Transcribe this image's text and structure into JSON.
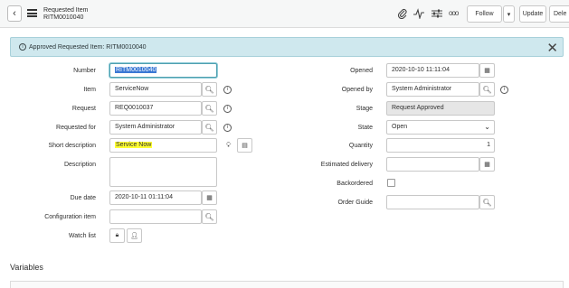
{
  "header": {
    "record_type": "Requested Item",
    "record_number": "RITM0010040",
    "follow_label": "Follow",
    "update_label": "Update",
    "delete_label": "Dele",
    "more_label": "ooo"
  },
  "banner": {
    "message": "Approved Requested Item: RITM0010040"
  },
  "form": {
    "left": {
      "number": {
        "label": "Number",
        "value": "RITM0010040"
      },
      "item": {
        "label": "Item",
        "value": "ServiceNow"
      },
      "request": {
        "label": "Request",
        "value": "REQ0010037"
      },
      "requested_for": {
        "label": "Requested for",
        "value": "System Administrator"
      },
      "short_description": {
        "label": "Short description",
        "value": "Service Now"
      },
      "description": {
        "label": "Description",
        "value": ""
      },
      "due_date": {
        "label": "Due date",
        "value": "2020-10-11 01:11:04"
      },
      "configuration_item": {
        "label": "Configuration item",
        "value": ""
      },
      "watch_list": {
        "label": "Watch list"
      }
    },
    "right": {
      "opened": {
        "label": "Opened",
        "value": "2020-10-10 11:11:04"
      },
      "opened_by": {
        "label": "Opened by",
        "value": "System Administrator"
      },
      "stage": {
        "label": "Stage",
        "value": "Request Approved"
      },
      "state": {
        "label": "State",
        "value": "Open"
      },
      "quantity": {
        "label": "Quantity",
        "value": "1"
      },
      "estimated_delivery": {
        "label": "Estimated delivery",
        "value": ""
      },
      "backordered": {
        "label": "Backordered",
        "checked": false
      },
      "order_guide": {
        "label": "Order Guide",
        "value": ""
      }
    }
  },
  "sections": {
    "variables": "Variables"
  },
  "icons": {
    "attachment": "paperclip-icon",
    "activity": "pulse-icon",
    "settings": "sliders-icon",
    "search": "magnifier-icon",
    "info": "info-icon",
    "calendar": "calendar-icon"
  },
  "colors": {
    "banner_bg": "#cfe8ee",
    "highlight": "#ffff33",
    "selection": "#3b78d4"
  }
}
